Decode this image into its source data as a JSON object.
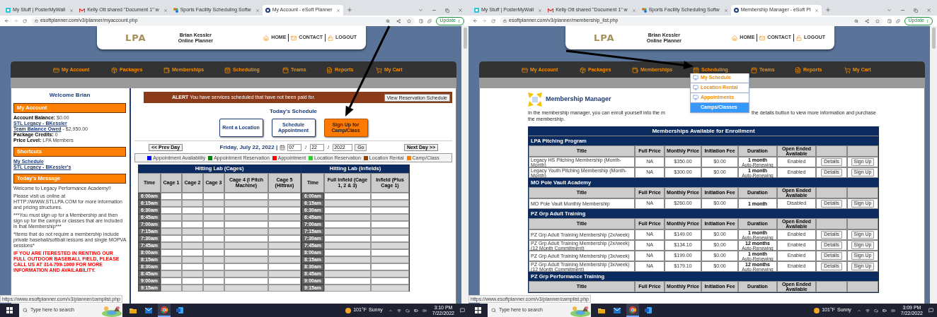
{
  "windows": [
    {
      "tabs": [
        {
          "title": "My Stuff | PosterMyWall",
          "selected": false
        },
        {
          "title": "Kelly Ott shared \"Document 1\" w",
          "selected": false
        },
        {
          "title": "Sports Facility Scheduling Softw",
          "selected": false
        },
        {
          "title": "My Account - eSoft Planner",
          "selected": true
        }
      ],
      "url": "esoftplanner.com/v3/planner/myaccount.php",
      "update_button": "Update",
      "site": {
        "logo": "LPA",
        "user_name": "Brian Kessler",
        "user_role": "Online Planner",
        "links": [
          "HOME",
          "CONTACT",
          "LOGOUT"
        ]
      },
      "nav": [
        {
          "label": "My Account"
        },
        {
          "label": "Packages"
        },
        {
          "label": "Memberships"
        },
        {
          "label": "Scheduling"
        },
        {
          "label": "Teams"
        },
        {
          "label": "Reports"
        },
        {
          "label": "My Cart"
        }
      ],
      "page": {
        "kind": "account",
        "sidebar": {
          "welcome": "Welcome Brian",
          "account_heading": "My Account",
          "account_lines": [
            {
              "label": "Account Balance:",
              "value": "$0.00",
              "link": false
            },
            {
              "label": "STL Legacy - BKessler",
              "link": true
            },
            {
              "label": "Team Balance Owed",
              "value": "- $2,950.00",
              "link": true
            },
            {
              "label": "Package Credits:",
              "value": "0",
              "link": false
            },
            {
              "label": "Price Level:",
              "value": "LPA Members",
              "link": false
            }
          ],
          "shortcuts_heading": "Shortcuts",
          "shortcuts": [
            "My Schedule",
            "STL Legacy - BKessler's"
          ],
          "message_heading": "Today's Message",
          "message": [
            {
              "kind": "normal",
              "text": "Welcome to Legacy Performance Academy!!"
            },
            {
              "kind": "normal",
              "text": "Please visit us online at HTTP://WWW.STLLPA.COM for more information and pricing structures."
            },
            {
              "kind": "normal",
              "text": "***You must sign up for a Membership and then sign up for the camps or classes that are included in that Membership***"
            },
            {
              "kind": "normal",
              "text": "*Items that do not require a membership include private baseball/softball lessons and single MOPVA sessions*"
            },
            {
              "kind": "alert",
              "text": "IF YOU ARE ITERESTED IN RENTING OUR FULL OUTDOOR BASEBALL FIELD, PLEASE CALL US AT 314-709-1009 FOR MORE INFORMATION AND AVAILABILITY."
            }
          ]
        },
        "alert": {
          "text": "**ALERT** You have services scheduled that have not been paid for.",
          "button": "View Reservation Schedule"
        },
        "schedule_title": "Today's Schedule",
        "actions": [
          {
            "label": "Rent a Location",
            "highlighted": false
          },
          {
            "label": "Schedule Appointment",
            "highlighted": false
          },
          {
            "label": "Sign Up for Camp/Class",
            "highlighted": true
          }
        ],
        "date_nav": {
          "prev": "<< Prev Day",
          "date": "Friday, July 22, 2022 |",
          "fields": [
            "07",
            "22",
            "2022"
          ],
          "separators": [
            "/",
            "/"
          ],
          "go": "Go",
          "next": "Next Day >>"
        },
        "legend": [
          {
            "label": "Appointment Availability",
            "color": "#0000ff"
          },
          {
            "label": "Appointment Reservation",
            "color": "#008000"
          },
          {
            "label": "Appointment",
            "color": "#ff0000"
          },
          {
            "label": "Location Reservation",
            "color": "#33cc33"
          },
          {
            "label": "Location Rental",
            "color": "#8b4513"
          },
          {
            "label": "Camp/Class",
            "color": "#ff8000"
          }
        ],
        "schedules": [
          {
            "title": "Hitting Lab (Cages)",
            "columns": [
              "Time",
              "Cage 1",
              "Cage 2",
              "Cage 3",
              "Cage 4 (I Pitch Machine)",
              "Cage 5 (Hittrax)"
            ],
            "times": [
              "6:00am",
              "6:15am",
              "6:30am",
              "6:45am",
              "7:00am",
              "7:15am",
              "7:30am",
              "7:45am",
              "8:00am",
              "8:15am",
              "8:30am",
              "8:45am",
              "9:00am",
              "9:15am"
            ]
          },
          {
            "title": "Hitting Lab (Infields)",
            "columns": [
              "Time",
              "Full Infield (Cage 1, 2 & 3)",
              "Infield (Plus Cage 1)"
            ],
            "times": [
              "6:00am",
              "6:15am",
              "6:30am",
              "6:45am",
              "7:00am",
              "7:15am",
              "7:30am",
              "7:45am",
              "8:00am",
              "8:15am",
              "8:30am",
              "8:45am",
              "9:00am",
              "9:15am"
            ]
          }
        ]
      },
      "status_url": "https://www.esoftplanner.com/v3/planner/camplist.php",
      "taskbar": {
        "search": "Type here to search",
        "temperature": "101°F",
        "weather": "Sunny",
        "time": "3:10 PM",
        "date": "7/22/2022"
      }
    },
    {
      "tabs": [
        {
          "title": "My Stuff | PosterMyWall",
          "selected": false
        },
        {
          "title": "Kelly Ott shared \"Document 1\" w",
          "selected": false
        },
        {
          "title": "Sports Facility Scheduling Softw",
          "selected": false
        },
        {
          "title": "Membership Manager - eSoft Pl",
          "selected": true
        }
      ],
      "url": "esoftplanner.com/v3/planner/membership_list.php",
      "update_button": "Update",
      "site": {
        "logo": "LPA",
        "user_name": "Brian Kessler",
        "user_role": "Online Planner",
        "links": [
          "HOME",
          "CONTACT",
          "LOGOUT"
        ]
      },
      "nav": [
        {
          "label": "My Account"
        },
        {
          "label": "Packages"
        },
        {
          "label": "Memberships"
        },
        {
          "label": "Scheduling",
          "menu": [
            {
              "label": "My Schedule",
              "selected": false
            },
            {
              "label": "Location Rental",
              "selected": false
            },
            {
              "label": "Appointments",
              "selected": false
            },
            {
              "label": "Camps/Classes",
              "selected": true
            }
          ]
        },
        {
          "label": "Teams"
        },
        {
          "label": "Reports"
        },
        {
          "label": "My Cart"
        }
      ],
      "page": {
        "kind": "memberships",
        "title": "Membership Manager",
        "description": [
          "In the membership manager, you can enroll yourself into the m",
          "the details button to view more information and purchase the membership."
        ],
        "table_title": "Memberships Available for Enrollment",
        "groups": [
          {
            "name": "LPA Pitching Program",
            "columns": [
              "Title",
              "Full Price",
              "Monthly Price",
              "Initiation Fee",
              "Duration",
              "Open Ended Available"
            ],
            "rows": [
              {
                "title": "Legacy HS Pitching Membership (Month-Month)",
                "full_price": "NA",
                "monthly_price": "$350.00",
                "initiation_fee": "$0.00",
                "duration": "1 month",
                "renewal": "Auto-Renewing",
                "open_ended": "Enabled",
                "actions": [
                  "Details",
                  "Sign Up"
                ]
              },
              {
                "title": "Legacy Youth Pitching Membership (Month-Month)",
                "full_price": "NA",
                "monthly_price": "$300.00",
                "initiation_fee": "$0.00",
                "duration": "1 month",
                "renewal": "Auto-Renewing",
                "open_ended": "Enabled",
                "actions": [
                  "Details",
                  "Sign Up"
                ]
              }
            ]
          },
          {
            "name": "MO Pole Vault Academy",
            "columns": [
              "Title",
              "Full Price",
              "Monthly Price",
              "Initiation Fee",
              "Duration",
              "Open Ended Available"
            ],
            "rows": [
              {
                "title": "MO Pole Vault Monthly Membership",
                "full_price": "NA",
                "monthly_price": "$260.00",
                "initiation_fee": "$0.00",
                "duration": "1 month",
                "open_ended": "Disabled",
                "actions": [
                  "Details",
                  "Sign Up"
                ]
              }
            ]
          },
          {
            "name": "PZ Grp Adult Training",
            "columns": [
              "Title",
              "Full Price",
              "Monthly Price",
              "Initiation Fee",
              "Duration",
              "Open Ended Available"
            ],
            "rows": [
              {
                "title": "PZ Grp Adult Training Membership (2x/week)",
                "full_price": "NA",
                "monthly_price": "$149.00",
                "initiation_fee": "$0.00",
                "duration": "1 month",
                "renewal": "Auto-Renewing",
                "open_ended": "Enabled",
                "actions": [
                  "Details",
                  "Sign Up"
                ]
              },
              {
                "title": "PZ Grp Adult Training Membership (2x/week) (12 Month Commitment)",
                "full_price": "NA",
                "monthly_price": "$134.10",
                "initiation_fee": "$0.00",
                "duration": "12 months",
                "renewal": "Auto-Renewing",
                "open_ended": "Enabled",
                "actions": [
                  "Details",
                  "Sign Up"
                ]
              },
              {
                "title": "PZ Grp Adult Training Membership (3x/week)",
                "full_price": "NA",
                "monthly_price": "$199.00",
                "initiation_fee": "$0.00",
                "duration": "1 month",
                "renewal": "Auto-Renewing",
                "open_ended": "Enabled",
                "actions": [
                  "Details",
                  "Sign Up"
                ]
              },
              {
                "title": "PZ Grp Adult Training Membership (3x/week) (12 Month Commitment)",
                "full_price": "NA",
                "monthly_price": "$179.10",
                "initiation_fee": "$0.00",
                "duration": "12 months",
                "renewal": "Auto-Renewing",
                "open_ended": "Enabled",
                "actions": [
                  "Details",
                  "Sign Up"
                ]
              }
            ]
          },
          {
            "name": "PZ Grp Performance Training",
            "columns": [
              "Title",
              "Full Price",
              "Monthly Price",
              "Initiation Fee",
              "Duration",
              "Open Ended Available"
            ]
          }
        ]
      },
      "status_url": "https://www.esoftplanner.com/v3/planner/camplist.php",
      "taskbar": {
        "search": "Type here to search",
        "temperature": "101°F",
        "weather": "Sunny",
        "time": "3:09 PM",
        "date": "7/22/2022"
      }
    }
  ]
}
